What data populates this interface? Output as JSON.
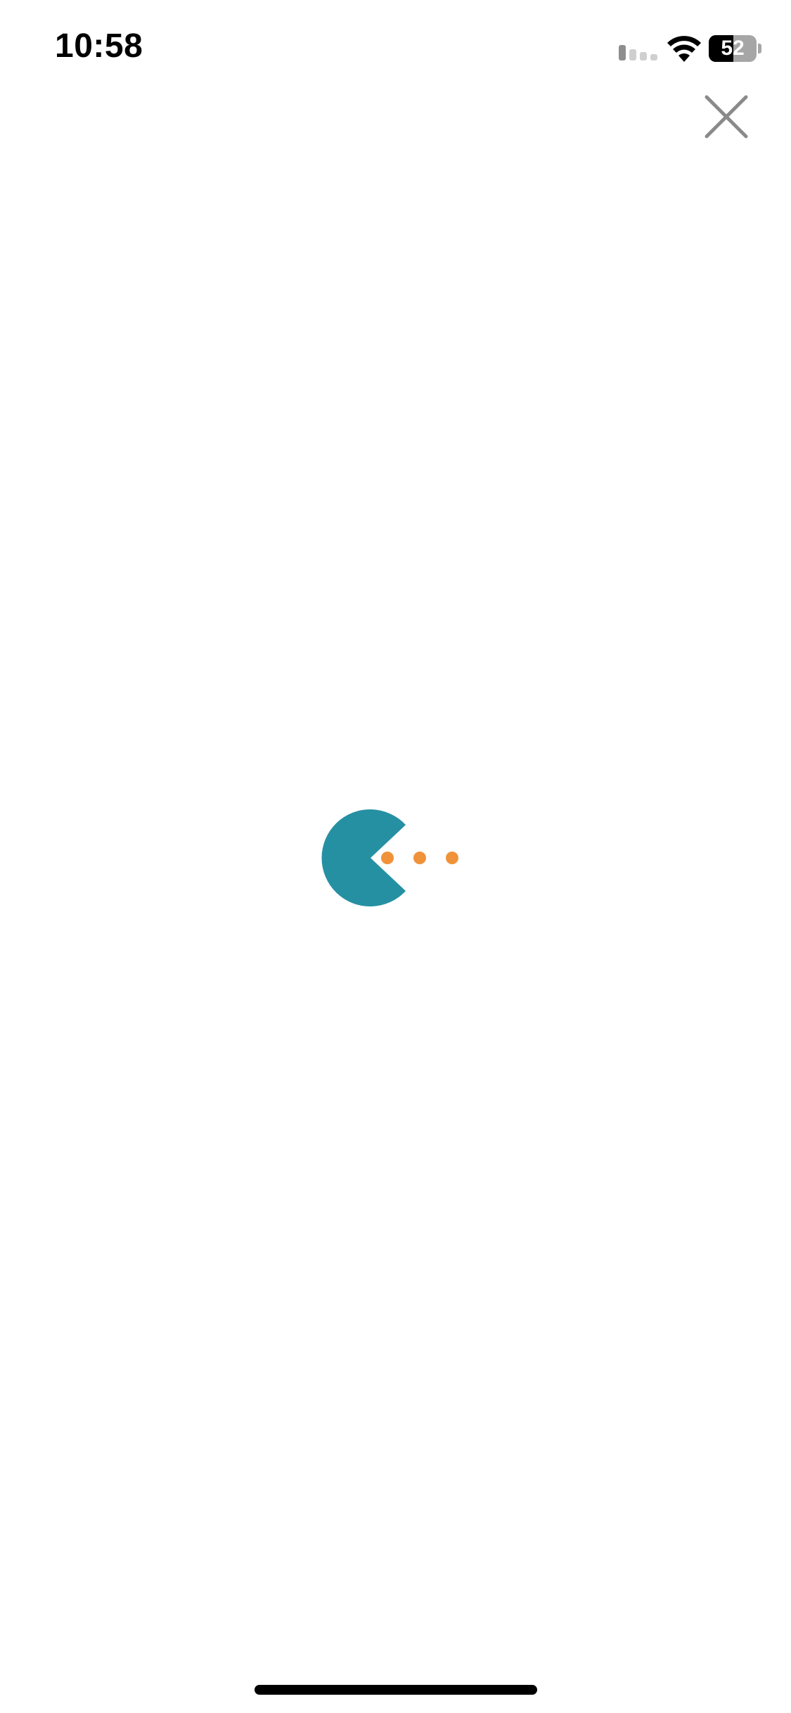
{
  "status_bar": {
    "time": "10:58",
    "battery_level": "52",
    "battery_fraction": 0.52,
    "cellular_icon": "cellular-signal-icon",
    "wifi_icon": "wifi-icon",
    "battery_icon": "battery-icon"
  },
  "close_button": {
    "icon": "close-icon",
    "color": "#8a8a8a"
  },
  "loader": {
    "icon": "pacman-loading-icon",
    "body_color": "#2690a3",
    "dot_color": "#f0923a",
    "dot_count": 3
  }
}
